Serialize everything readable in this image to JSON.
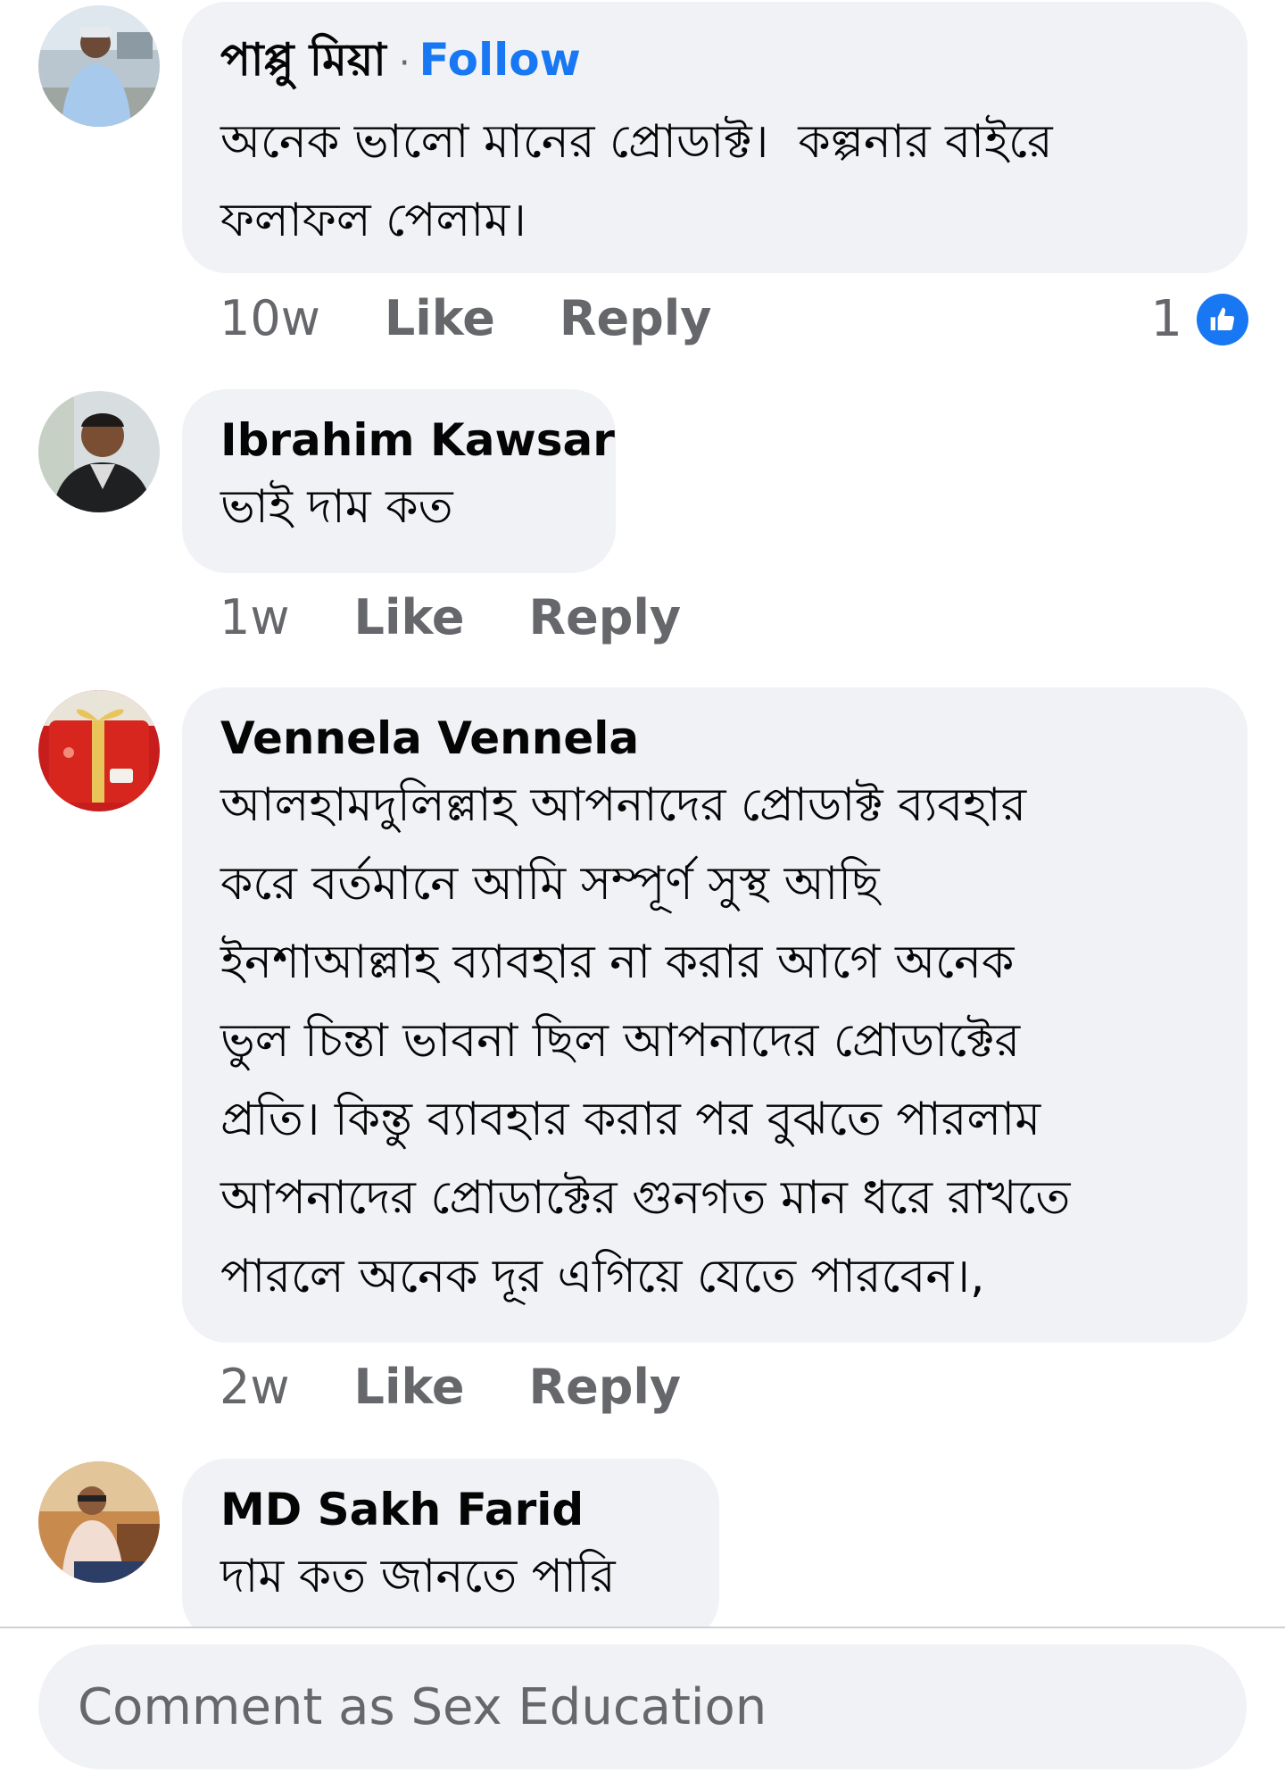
{
  "comments": [
    {
      "author": "পাপ্পু মিয়া",
      "separator": "·",
      "follow_label": "Follow",
      "lines": [
        "অনেক ভালো মানের প্রোডাক্ট।  কল্পনার বাইরে",
        "ফলাফল পেলাম।"
      ],
      "time": "10w",
      "like_label": "Like",
      "reply_label": "Reply",
      "reaction_count": "1",
      "avatar_icon": "person-photo"
    },
    {
      "author": "Ibrahim Kawsar",
      "lines": [
        "ভাই দাম কত"
      ],
      "time": "1w",
      "like_label": "Like",
      "reply_label": "Reply",
      "avatar_icon": "person-photo"
    },
    {
      "author": "Vennela Vennela",
      "lines": [
        "আলহামদুলিল্লাহ আপনাদের প্রোডাক্ট ব্যবহার",
        "করে বর্তমানে আমি সম্পূর্ণ সুস্থ আছি",
        "ইনশাআল্লাহ ব্যাবহার না করার আগে অনেক",
        "ভুল চিন্তা ভাবনা ছিল আপনাদের প্রোডাক্টের",
        "প্রতি। কিন্তু ব্যাবহার করার পর বুঝতে পারলাম",
        "আপনাদের প্রোডাক্টের গুনগত মান ধরে রাখতে",
        "পারলে অনেক দূর এগিয়ে যেতে পারবেন।,"
      ],
      "time": "2w",
      "like_label": "Like",
      "reply_label": "Reply",
      "avatar_icon": "gift-photo"
    },
    {
      "author": "MD Sakh Farid",
      "lines": [
        "দাম কত জানতে পারি"
      ],
      "avatar_icon": "person-photo"
    }
  ],
  "composer": {
    "placeholder": "Comment as Sex Education"
  },
  "colors": {
    "bubble": "#f0f2f5",
    "link": "#1877f2",
    "meta": "#65676b",
    "text": "#050505"
  }
}
